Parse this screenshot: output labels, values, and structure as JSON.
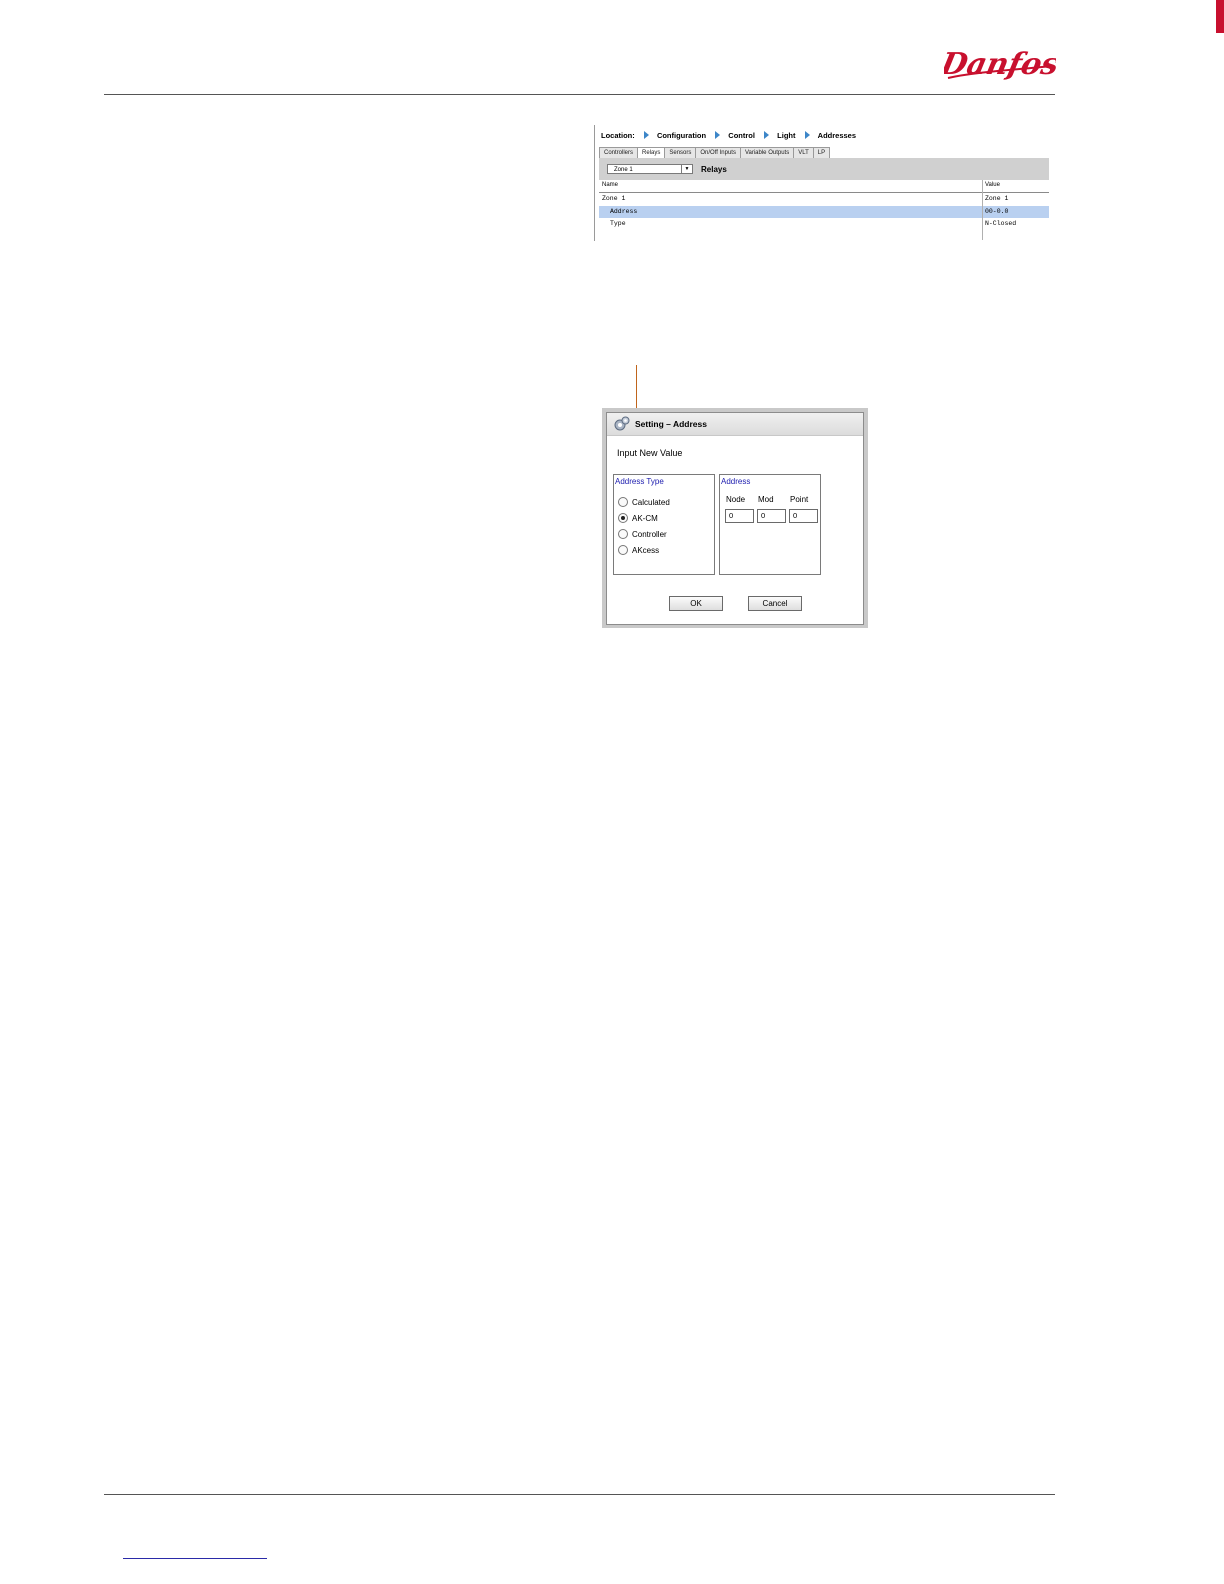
{
  "brand": {
    "logo_text": "Danfoss",
    "accent": "#c8102e"
  },
  "screen1": {
    "location_label": "Location:",
    "breadcrumb": [
      "Configuration",
      "Control",
      "Light",
      "Addresses"
    ],
    "tabs": [
      "Controllers",
      "Relays",
      "Sensors",
      "On/Off Inputs",
      "Variable Outputs",
      "VLT",
      "LP"
    ],
    "active_tab": "Relays",
    "zone_select_value": "Zone 1",
    "section_title": "Relays",
    "table": {
      "columns": [
        "Name",
        "Value"
      ],
      "rows": [
        {
          "name": "Zone 1",
          "value": "Zone 1",
          "selected": false
        },
        {
          "name": "Address",
          "value": "00-0.0",
          "selected": true
        },
        {
          "name": "Type",
          "value": "N-Closed",
          "selected": false
        }
      ]
    },
    "selection_color": "#b9d0f0"
  },
  "dialog": {
    "title": "Setting –  Address",
    "prompt": "Input New Value",
    "address_type": {
      "title": "Address Type",
      "options": [
        "Calculated",
        "AK-CM",
        "Controller",
        "AKcess"
      ],
      "selected": "AK-CM"
    },
    "address": {
      "title": "Address",
      "fields": [
        {
          "label": "Node",
          "value": "0"
        },
        {
          "label": "Mod",
          "value": "0"
        },
        {
          "label": "Point",
          "value": "0"
        }
      ]
    },
    "ok_label": "OK",
    "cancel_label": "Cancel"
  }
}
